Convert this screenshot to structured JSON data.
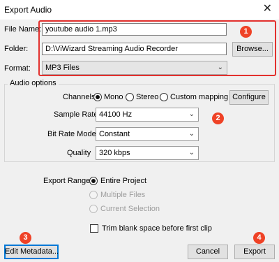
{
  "window": {
    "title": "Export Audio",
    "close_glyph": "✕"
  },
  "file_section": {
    "file_name_label": "File Name:",
    "file_name_value": "youtube audio 1.mp3",
    "folder_label": "Folder:",
    "folder_value": "D:\\ViWizard Streaming Audio Recorder",
    "browse_label": "Browse...",
    "format_label": "Format:",
    "format_value": "MP3 Files"
  },
  "audio_options": {
    "group_title": "Audio options",
    "channels_label": "Channels",
    "channel_options": [
      "Mono",
      "Stereo",
      "Custom mapping"
    ],
    "channel_selected": "Mono",
    "configure_label": "Configure",
    "sample_rate_label": "Sample Rate",
    "sample_rate_value": "44100 Hz",
    "bit_rate_mode_label": "Bit Rate Mode",
    "bit_rate_mode_value": "Constant",
    "quality_label": "Quality",
    "quality_value": "320 kbps"
  },
  "export_range": {
    "label": "Export Range:",
    "options": [
      "Entire Project",
      "Multiple Files",
      "Current Selection"
    ],
    "selected": "Entire Project",
    "trim_label": "Trim blank space before first clip",
    "trim_checked": false
  },
  "footer": {
    "edit_metadata_label": "Edit Metadata...",
    "cancel_label": "Cancel",
    "export_label": "Export"
  },
  "annotations": {
    "badges": [
      "1",
      "2",
      "3",
      "4"
    ],
    "highlight_color": "#e3312e",
    "badge_color": "#ef4226"
  }
}
